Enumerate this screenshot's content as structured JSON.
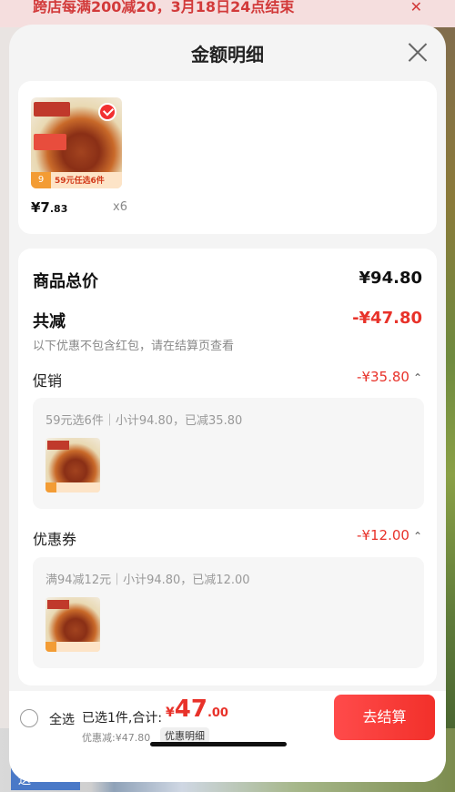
{
  "background": {
    "banner_text": "跨店每满200减20，3月18日24点结束",
    "banner_close": "✕",
    "bottom_button": "送"
  },
  "sheet": {
    "title": "金额明细"
  },
  "product": {
    "price_main": "¥7",
    "price_decimal": ".83",
    "quantity": "x6",
    "thumb_promo": "59元任选6件",
    "thumb_badge": "9"
  },
  "summary": {
    "total_label": "商品总价",
    "total_value": "¥94.80",
    "reduction_label": "共减",
    "reduction_value": "-¥47.80",
    "note": "以下优惠不包含红包，请在结算页查看"
  },
  "promotion": {
    "label": "促销",
    "value": "-¥35.80",
    "detail": "59元选6件｜小计94.80，已减35.80"
  },
  "coupon": {
    "label": "优惠券",
    "value": "-¥12.00",
    "detail": "满94减12元｜小计94.80，已减12.00"
  },
  "footer": {
    "select_all": "全选",
    "selected_info": "已选1件,合计:",
    "currency": "¥",
    "total_int": "47",
    "total_dec": ".00",
    "discount": "优惠减:¥47.80",
    "detail_link": "优惠明细",
    "checkout": "去结算"
  },
  "colors": {
    "accent_red": "#e8322a",
    "checkout_gradient_start": "#ff4b4b"
  }
}
